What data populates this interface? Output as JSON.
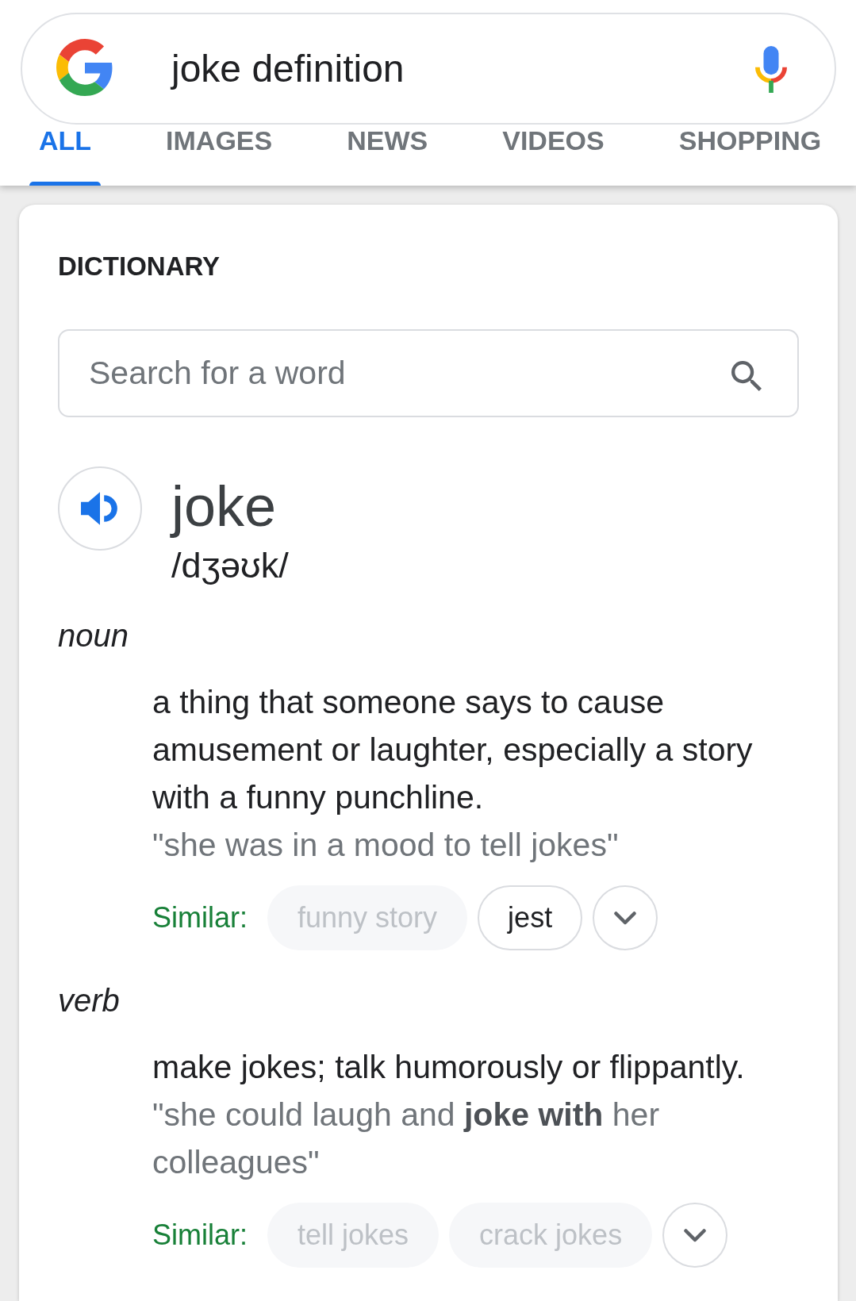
{
  "search_bar": {
    "query": "joke definition"
  },
  "tabs": [
    {
      "label": "ALL",
      "selected": true
    },
    {
      "label": "IMAGES",
      "selected": false
    },
    {
      "label": "NEWS",
      "selected": false
    },
    {
      "label": "VIDEOS",
      "selected": false
    },
    {
      "label": "SHOPPING",
      "selected": false
    }
  ],
  "dictionary": {
    "title": "DICTIONARY",
    "search": {
      "placeholder": "Search for a word"
    },
    "word": "joke",
    "pronunciation": "/dʒəʊk/",
    "senses": [
      {
        "part_of_speech": "noun",
        "definition": "a thing that someone says to cause amusement or laughter, especially a story with a funny punchline.",
        "example": "\"she was in a mood to tell jokes\"",
        "similar_label": "Similar:",
        "similar": [
          {
            "label": "funny story",
            "disabled": true
          },
          {
            "label": "jest",
            "disabled": false
          }
        ]
      },
      {
        "part_of_speech": "verb",
        "definition": "make jokes; talk humorously or flippantly.",
        "example": "\"she could laugh and **joke with** her colleagues\"",
        "similar_label": "Similar:",
        "similar": [
          {
            "label": "tell jokes",
            "disabled": true
          },
          {
            "label": "crack jokes",
            "disabled": true
          }
        ]
      }
    ]
  }
}
